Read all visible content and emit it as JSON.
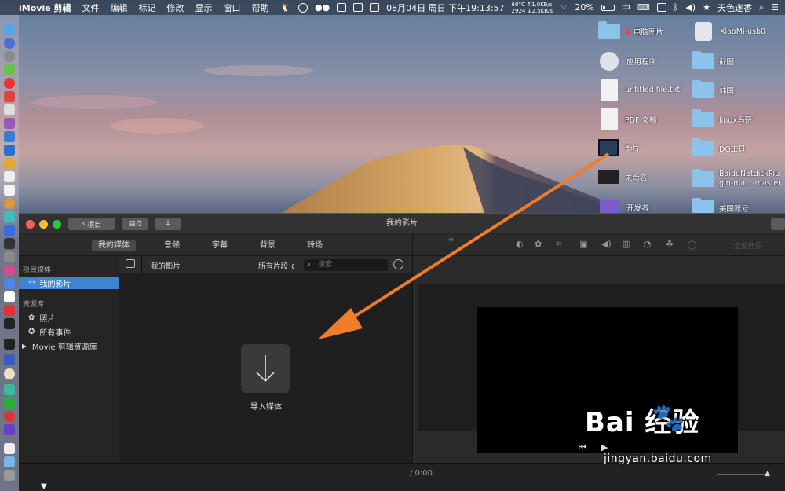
{
  "menubar": {
    "app_name": "iMovie 剪辑",
    "menus": [
      "文件",
      "编辑",
      "标记",
      "修改",
      "显示",
      "窗口",
      "帮助"
    ],
    "date": "08月04日 周日 下午19:13:57",
    "temp": "60°C",
    "rpm": "2924",
    "up": "↑1.0KB/s",
    "down": "↓2.5KB/s",
    "battery": "20%",
    "input_method": "中",
    "user": "天色迷香"
  },
  "desktop": {
    "icons": [
      {
        "label": "电脑图片",
        "kind": "folder",
        "tag": "#e84949"
      },
      {
        "label": "XiaoMi-usb0",
        "kind": "drive"
      },
      {
        "label": "应用程序",
        "kind": "app"
      },
      {
        "label": "截图",
        "kind": "folder"
      },
      {
        "label": "untitled file.txt",
        "kind": "doc"
      },
      {
        "label": "韩国",
        "kind": "folder"
      },
      {
        "label": "PDF 文稿",
        "kind": "doc"
      },
      {
        "label": "linux鸟哥",
        "kind": "folder"
      },
      {
        "label": "影片",
        "kind": "movie"
      },
      {
        "label": "DG工具",
        "kind": "folder"
      },
      {
        "label": "未命名",
        "kind": "image"
      },
      {
        "label": "BaiduNetdiskPlu",
        "label2": "gin-ma...-master",
        "kind": "folder"
      },
      {
        "label": "开发者",
        "kind": "app"
      },
      {
        "label": "美国账号",
        "kind": "folder"
      }
    ]
  },
  "window": {
    "title": "我的影片",
    "back_button": "项目",
    "tabs": [
      "我的媒体",
      "音频",
      "字幕",
      "背景",
      "转场"
    ],
    "active_tab": "我的媒体",
    "sidebar": {
      "section1": "项目媒体",
      "project": "我的影片",
      "section2": "资源库",
      "photos": "照片",
      "all_events": "所有事件",
      "library": "iMovie 剪辑资源库"
    },
    "browser": {
      "title": "我的影片",
      "filter": "所有片段",
      "search_placeholder": "搜索",
      "import_label": "导入媒体"
    },
    "viewer": {
      "reset_all": "全部还原",
      "timecode": "/ 0:00"
    }
  },
  "watermark": {
    "text": "Bai  经验",
    "url": "jingyan.baidu.com"
  },
  "colors": {
    "selection": "#3f83d5",
    "arrow": "#f07d2a",
    "window_bg": "#262626"
  }
}
